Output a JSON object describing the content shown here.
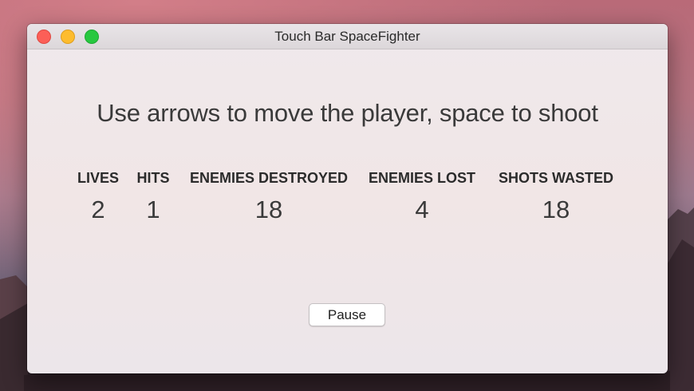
{
  "window": {
    "title": "Touch Bar SpaceFighter"
  },
  "main": {
    "instructions": "Use arrows to move the player, space to shoot",
    "stats": [
      {
        "label": "LIVES",
        "value": "2"
      },
      {
        "label": "HITS",
        "value": "1"
      },
      {
        "label": "ENEMIES DESTROYED",
        "value": "18"
      },
      {
        "label": "ENEMIES LOST",
        "value": "4"
      },
      {
        "label": "SHOTS WASTED",
        "value": "18"
      }
    ],
    "pause_label": "Pause"
  },
  "colors": {
    "close": "#fc5f57",
    "minimize": "#fdbc2e",
    "maximize": "#28c840"
  }
}
